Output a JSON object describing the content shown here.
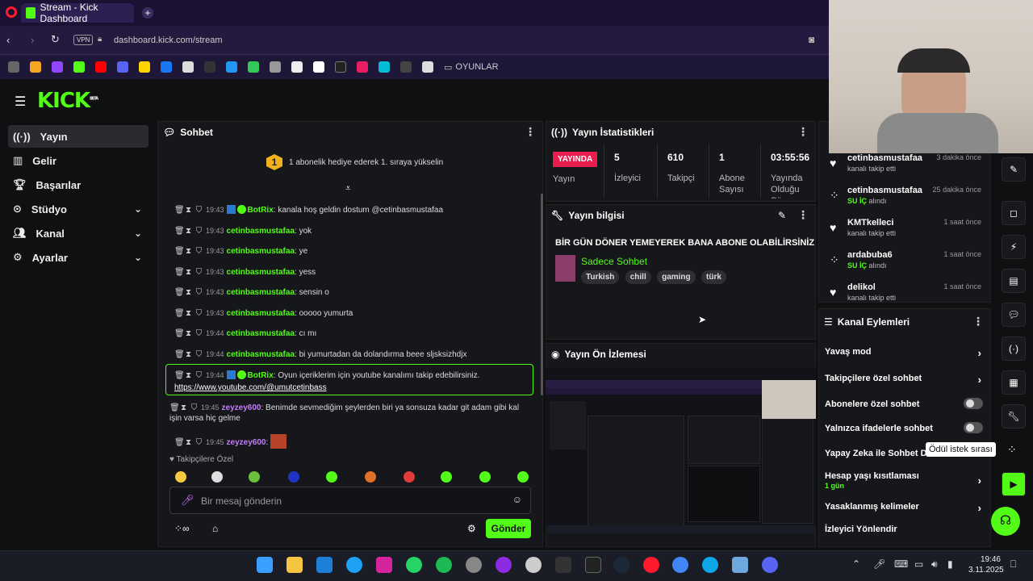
{
  "browser": {
    "tab_title": "Stream - Kick Dashboard",
    "url": "dashboard.kick.com/stream",
    "vpn_label": "VPN",
    "bookmark_folder": "OYUNLAR"
  },
  "header": {
    "logo": "KICK",
    "beta": "BETA"
  },
  "sidebar": {
    "items": [
      {
        "label": "Yayın"
      },
      {
        "label": "Gelir"
      },
      {
        "label": "Başarılar"
      },
      {
        "label": "Stüdyo"
      },
      {
        "label": "Kanal"
      },
      {
        "label": "Ayarlar"
      }
    ]
  },
  "chat": {
    "title": "Sohbet",
    "goal_badge": "1",
    "goal_text": "1 abonelik hediye ederek 1. sıraya yükselin",
    "messages": [
      {
        "time": "19:43",
        "user": "BotRix",
        "text": "kanala hoş geldin dostum @cetinbasmustafaa"
      },
      {
        "time": "19:43",
        "user": "cetinbasmustafaa",
        "text": "yok"
      },
      {
        "time": "19:43",
        "user": "cetinbasmustafaa",
        "text": "ye"
      },
      {
        "time": "19:43",
        "user": "cetinbasmustafaa",
        "text": "yess"
      },
      {
        "time": "19:43",
        "user": "cetinbasmustafaa",
        "text": "sensin o"
      },
      {
        "time": "19:43",
        "user": "cetinbasmustafaa",
        "text": "ooooo yumurta"
      },
      {
        "time": "19:44",
        "user": "cetinbasmustafaa",
        "text": "cı mı"
      },
      {
        "time": "19:44",
        "user": "cetinbasmustafaa",
        "text": "bi yumurtadan da dolandırma beee sljsksizhdjx"
      },
      {
        "time": "19:44",
        "user": "BotRix",
        "text": "Oyun içeriklerim için youtube kanalımı takip edebilirsiniz.",
        "link": "https://www.youtube.com/@umutcetinbass"
      },
      {
        "time": "19:45",
        "user": "zeyzey600",
        "text": "Benimde sevmediğim şeylerden biri ya sonsuza kadar git adam gibi kal işin varsa hiç gelme"
      },
      {
        "time": "19:45",
        "user": "zeyzey600",
        "text": ""
      }
    ],
    "followers_only_label": "Takipçilere Özel",
    "input_placeholder": "Bir mesaj gönderin",
    "send_label": "Gönder"
  },
  "stats": {
    "title": "Yayın İstatistikleri",
    "live_badge": "YAYINDA",
    "live_label": "Yayın",
    "viewers": "5",
    "viewers_label": "İzleyici",
    "followers": "610",
    "followers_label": "Takipçi",
    "subs": "1",
    "subs_label": "Abone Sayısı",
    "uptime": "03:55:56",
    "uptime_label": "Yayında Olduğu Süre"
  },
  "stream_info": {
    "title": "Yayın bilgisi",
    "stream_title": "BİR GÜN DÖNER YEMEYEREK BANA ABONE OLABİLİRSİNİZ",
    "category": "Sadece Sohbet",
    "tags": [
      "Turkish",
      "chill",
      "gaming",
      "türk"
    ]
  },
  "preview": {
    "title": "Yayın Ön İzlemesi"
  },
  "events": [
    {
      "name": "cetinbasmustafaa",
      "sub": "kanalı takip etti",
      "time": "3 dakika önce",
      "icon": "heart-icon"
    },
    {
      "name": "cetinbasmustafaa",
      "sub_strong": "SU İÇ",
      "sub": "alındı",
      "time": "25 dakika önce",
      "icon": "reward-icon"
    },
    {
      "name": "KMTkelleci",
      "sub": "kanalı takip etti",
      "time": "1 saat önce",
      "icon": "heart-icon"
    },
    {
      "name": "ardabuba6",
      "sub_strong": "SU İÇ",
      "sub": "alındı",
      "time": "1 saat önce",
      "icon": "reward-icon"
    },
    {
      "name": "delikol",
      "sub": "kanalı takip etti",
      "time": "1 saat önce",
      "icon": "heart-icon"
    }
  ],
  "channel_actions": {
    "title": "Kanal Eylemleri",
    "items": [
      {
        "label": "Yavaş mod"
      },
      {
        "label": "Takipçilere özel sohbet"
      },
      {
        "label": "Abonelere özel sohbet"
      },
      {
        "label": "Yalnızca ifadelerle sohbet"
      },
      {
        "label": "Yapay Zeka ile Sohbet De"
      },
      {
        "label": "Hesap yaşı kısıtlaması",
        "sub": "1 gün"
      },
      {
        "label": "Yasaklanmış kelimeler"
      },
      {
        "label": "İzleyici Yönlendir"
      }
    ]
  },
  "tooltip": "Ödül istek sırası",
  "taskbar": {
    "time": "19:46",
    "date": "3.11.2025"
  },
  "colors": {
    "accent": "#53fc18",
    "live": "#e91e4e",
    "purple": "#c47cff"
  }
}
